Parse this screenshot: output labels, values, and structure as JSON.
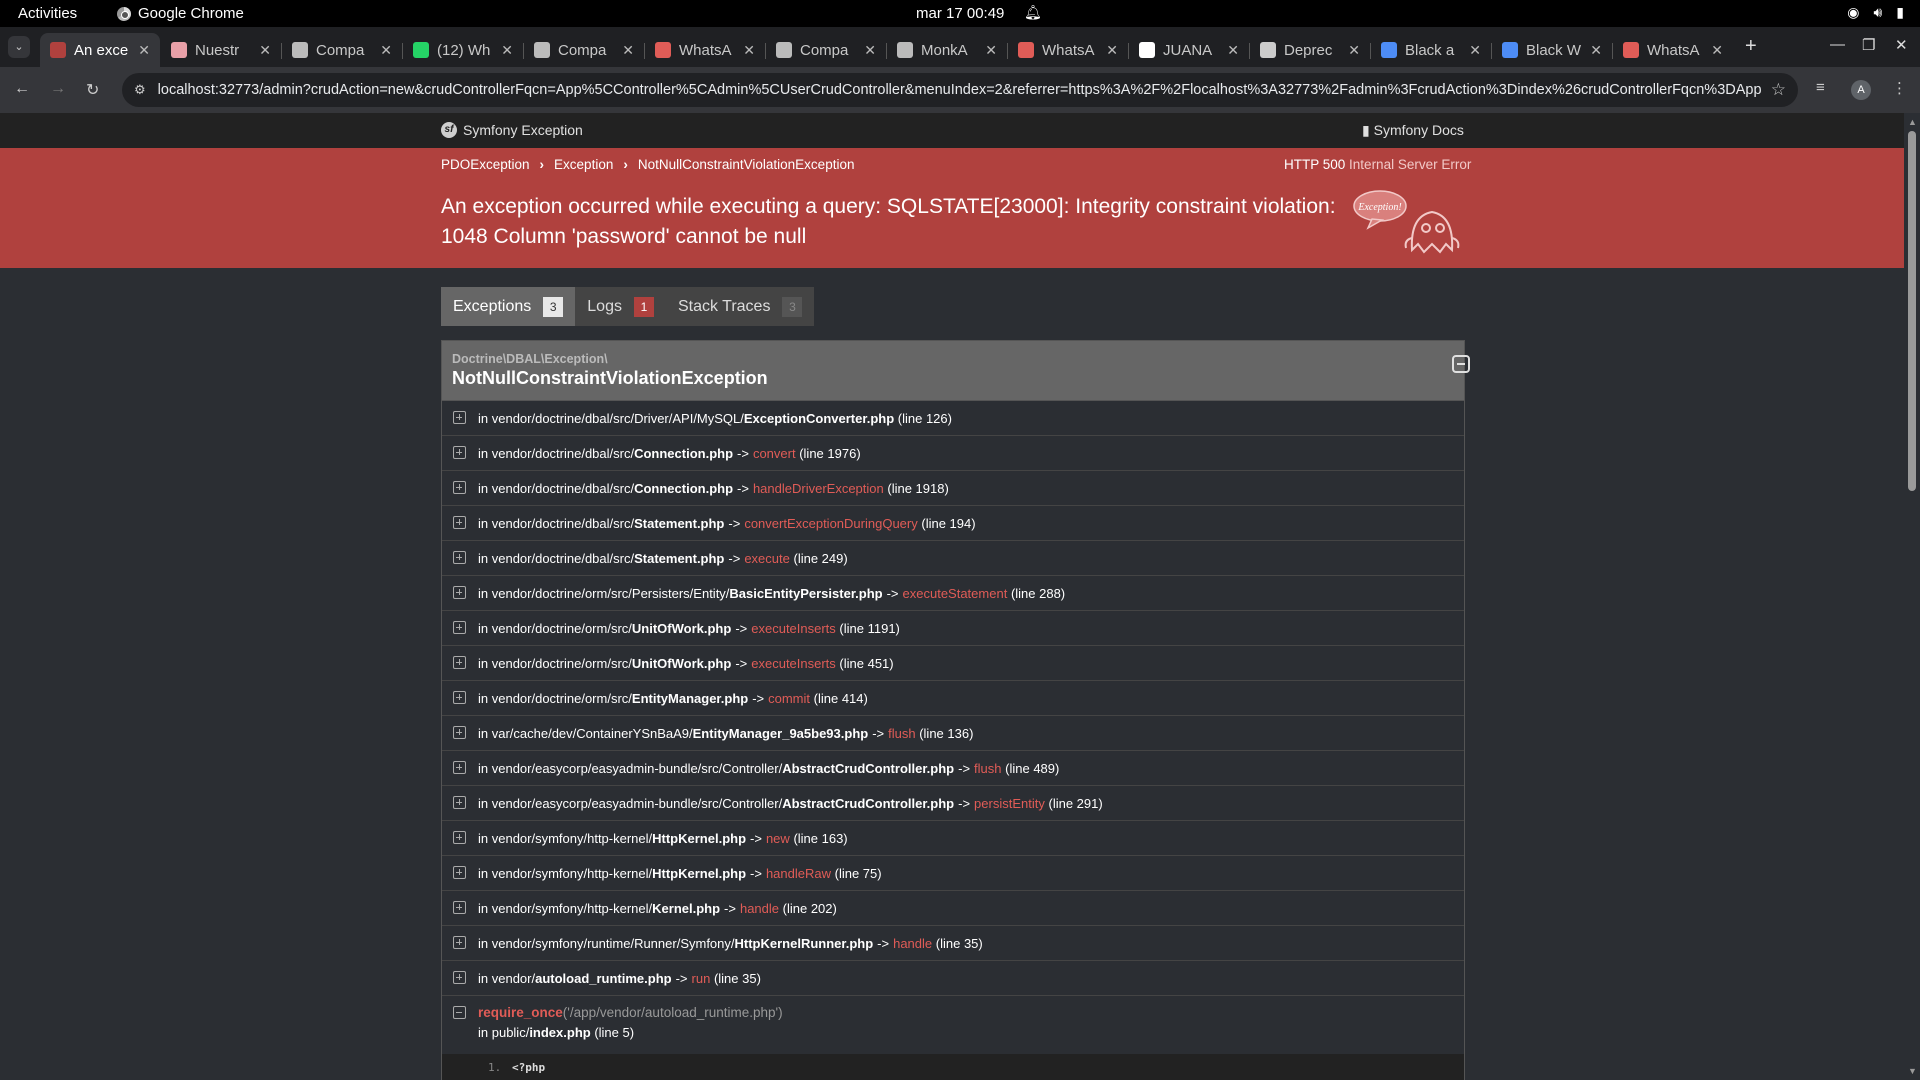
{
  "os": {
    "activities": "Activities",
    "app_name": "Google Chrome",
    "clock": "mar 17  00:49"
  },
  "browser": {
    "tabs": [
      {
        "label": "An exce",
        "active": true,
        "favicon": "symfony-ghost-icon",
        "color": "#b0413e"
      },
      {
        "label": "Nuestr",
        "active": false,
        "favicon": "page-icon",
        "color": "#e8a0a8"
      },
      {
        "label": "Compa",
        "active": false,
        "favicon": "globe-icon",
        "color": "#bbbbbb"
      },
      {
        "label": "(12) Wh",
        "active": false,
        "favicon": "whatsapp-icon",
        "color": "#25d366"
      },
      {
        "label": "Compa",
        "active": false,
        "favicon": "globe-icon",
        "color": "#bbbbbb"
      },
      {
        "label": "WhatsA",
        "active": false,
        "favicon": "alert-icon",
        "color": "#e05c57"
      },
      {
        "label": "Compa",
        "active": false,
        "favicon": "globe-icon",
        "color": "#bbbbbb"
      },
      {
        "label": "MonkA",
        "active": false,
        "favicon": "globe-icon",
        "color": "#bbbbbb"
      },
      {
        "label": "WhatsA",
        "active": false,
        "favicon": "alert-icon",
        "color": "#e05c57"
      },
      {
        "label": "JUANA",
        "active": false,
        "favicon": "doc-icon",
        "color": "#ffffff"
      },
      {
        "label": "Deprec",
        "active": false,
        "favicon": "chatgpt-icon",
        "color": "#cccccc"
      },
      {
        "label": "Black a",
        "active": false,
        "favicon": "copilot-icon",
        "color": "#4d8cf5"
      },
      {
        "label": "Black W",
        "active": false,
        "favicon": "copilot-icon",
        "color": "#4d8cf5"
      },
      {
        "label": "WhatsA",
        "active": false,
        "favicon": "alert-icon",
        "color": "#e05c57"
      }
    ],
    "url": "localhost:32773/admin?crudAction=new&crudControllerFqcn=App%5CController%5CAdmin%5CUserCrudController&menuIndex=2&referrer=https%3A%2F%2Flocalhost%3A32773%2Fadmin%3FcrudAction%3Dindex%26crudControllerFqcn%3DApp...",
    "profile_initial": "A"
  },
  "symfony": {
    "brand": "Symfony Exception",
    "docs": "Symfony Docs",
    "breadcrumbs": [
      "PDOException",
      "Exception",
      "NotNullConstraintViolationException"
    ],
    "status_code": "HTTP 500",
    "status_text": "Internal Server Error",
    "message": "An exception occurred while executing a query: SQLSTATE[23000]: Integrity constraint violation: 1048 Column 'password' cannot be null",
    "ghost_label": "Exception!",
    "tabs": [
      {
        "label": "Exceptions",
        "count": "3",
        "style": "light",
        "active": true
      },
      {
        "label": "Logs",
        "count": "1",
        "style": "red",
        "active": false
      },
      {
        "label": "Stack Traces",
        "count": "3",
        "style": "dark",
        "active": false
      }
    ],
    "exception": {
      "namespace": "Doctrine\\DBAL\\Exception\\",
      "class": "NotNullConstraintViolationException",
      "traces": [
        {
          "path": "in vendor/doctrine/dbal/src/Driver/API/MySQL/",
          "file": "ExceptionConverter.php",
          "fn": "",
          "line": "(line 126)"
        },
        {
          "path": "in vendor/doctrine/dbal/src/",
          "file": "Connection.php",
          "fn": "convert",
          "line": "(line 1976)"
        },
        {
          "path": "in vendor/doctrine/dbal/src/",
          "file": "Connection.php",
          "fn": "handleDriverException",
          "line": "(line 1918)"
        },
        {
          "path": "in vendor/doctrine/dbal/src/",
          "file": "Statement.php",
          "fn": "convertExceptionDuringQuery",
          "line": "(line 194)"
        },
        {
          "path": "in vendor/doctrine/dbal/src/",
          "file": "Statement.php",
          "fn": "execute",
          "line": "(line 249)"
        },
        {
          "path": "in vendor/doctrine/orm/src/Persisters/Entity/",
          "file": "BasicEntityPersister.php",
          "fn": "executeStatement",
          "line": "(line 288)"
        },
        {
          "path": "in vendor/doctrine/orm/src/",
          "file": "UnitOfWork.php",
          "fn": "executeInserts",
          "line": "(line 1191)"
        },
        {
          "path": "in vendor/doctrine/orm/src/",
          "file": "UnitOfWork.php",
          "fn": "executeInserts",
          "line": "(line 451)"
        },
        {
          "path": "in vendor/doctrine/orm/src/",
          "file": "EntityManager.php",
          "fn": "commit",
          "line": "(line 414)"
        },
        {
          "path": "in var/cache/dev/ContainerYSnBaA9/",
          "file": "EntityManager_9a5be93.php",
          "fn": "flush",
          "line": "(line 136)"
        },
        {
          "path": "in vendor/easycorp/easyadmin-bundle/src/Controller/",
          "file": "AbstractCrudController.php",
          "fn": "flush",
          "line": "(line 489)"
        },
        {
          "path": "in vendor/easycorp/easyadmin-bundle/src/Controller/",
          "file": "AbstractCrudController.php",
          "fn": "persistEntity",
          "line": "(line 291)"
        },
        {
          "path": "in vendor/symfony/http-kernel/",
          "file": "HttpKernel.php",
          "fn": "new",
          "line": "(line 163)"
        },
        {
          "path": "in vendor/symfony/http-kernel/",
          "file": "HttpKernel.php",
          "fn": "handleRaw",
          "line": "(line 75)"
        },
        {
          "path": "in vendor/symfony/http-kernel/",
          "file": "Kernel.php",
          "fn": "handle",
          "line": "(line 202)"
        },
        {
          "path": "in vendor/symfony/runtime/Runner/Symfony/",
          "file": "HttpKernelRunner.php",
          "fn": "handle",
          "line": "(line 35)"
        },
        {
          "path": "in vendor/",
          "file": "autoload_runtime.php",
          "fn": "run",
          "line": "(line 35)"
        }
      ],
      "expanded": {
        "fn": "require_once",
        "args": "('/app/vendor/autoload_runtime.php')",
        "path": "in public/",
        "file": "index.php",
        "line": "(line 5)",
        "code_line_no": "1.",
        "code": "<?php"
      }
    }
  }
}
